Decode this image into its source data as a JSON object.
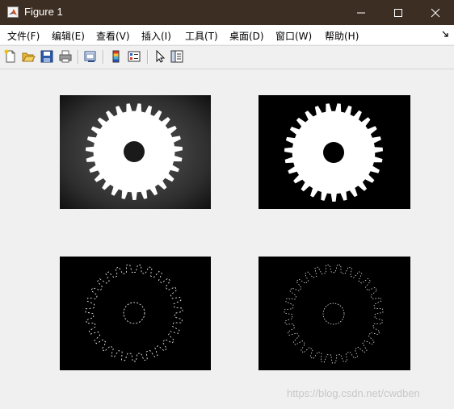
{
  "window": {
    "title": "Figure 1",
    "app_icon": "matlab-icon",
    "controls": [
      "minimize-icon",
      "maximize-icon",
      "close-icon"
    ]
  },
  "menu": {
    "items": [
      {
        "label": "文件(F)"
      },
      {
        "label": "编辑(E)"
      },
      {
        "label": "查看(V)"
      },
      {
        "label": "插入(I)"
      },
      {
        "label": "工具(T)"
      },
      {
        "label": "桌面(D)"
      },
      {
        "label": "窗口(W)"
      },
      {
        "label": "帮助(H)"
      }
    ],
    "overflow_icon": "dock-arrow-icon"
  },
  "toolbar": {
    "buttons": [
      "new-figure-icon",
      "open-file-icon",
      "save-icon",
      "print-icon",
      "link-plot-icon",
      "insert-colorbar-icon",
      "insert-legend-icon",
      "edit-plot-icon",
      "property-inspector-icon"
    ]
  },
  "figure": {
    "subplots": [
      {
        "content": "grayscale gear photo"
      },
      {
        "content": "binary gear mask"
      },
      {
        "content": "gear edge detection"
      },
      {
        "content": "gear edge detection"
      }
    ]
  },
  "watermark": "https://blog.csdn.net/cwdben",
  "colors": {
    "titlebar": "#3c2e23",
    "menubar": "#ffffff",
    "background": "#f0f0f0"
  }
}
